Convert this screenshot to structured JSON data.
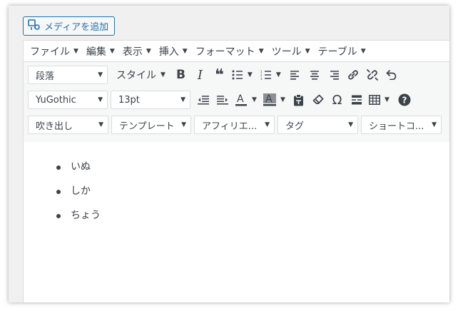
{
  "media_button": {
    "icon": "media-icon",
    "label": "メディアを追加"
  },
  "menubar": [
    {
      "label": "ファイル"
    },
    {
      "label": "編集"
    },
    {
      "label": "表示"
    },
    {
      "label": "挿入"
    },
    {
      "label": "フォーマット"
    },
    {
      "label": "ツール"
    },
    {
      "label": "テーブル"
    }
  ],
  "toolbar1": {
    "format_select": "段落",
    "style_label": "スタイル",
    "buttons": [
      "bold-icon",
      "italic-icon",
      "blockquote-icon",
      "bullet-list-icon",
      "numbered-list-icon",
      "align-left-icon",
      "align-center-icon",
      "align-right-icon",
      "link-icon",
      "unlink-icon",
      "undo-icon"
    ]
  },
  "toolbar2": {
    "font_family": "YuGothic",
    "font_size": "13pt",
    "buttons": [
      "outdent-icon",
      "indent-icon",
      "text-color-icon",
      "background-color-icon",
      "paste-text-icon",
      "clear-formatting-icon",
      "special-character-icon",
      "horizontal-line-icon",
      "table-icon",
      "help-icon"
    ]
  },
  "toolbar3": {
    "selects": [
      "吹き出し",
      "テンプレート",
      "アフィリエ...",
      "タグ",
      "ショートコ..."
    ]
  },
  "content": {
    "list_items": [
      "いぬ",
      "しか",
      "ちょう"
    ]
  },
  "colors": {
    "accent": "#2271b1",
    "text": "#3c434a",
    "border": "#dcdcde",
    "toolbar_bg": "#f6f7f7"
  }
}
